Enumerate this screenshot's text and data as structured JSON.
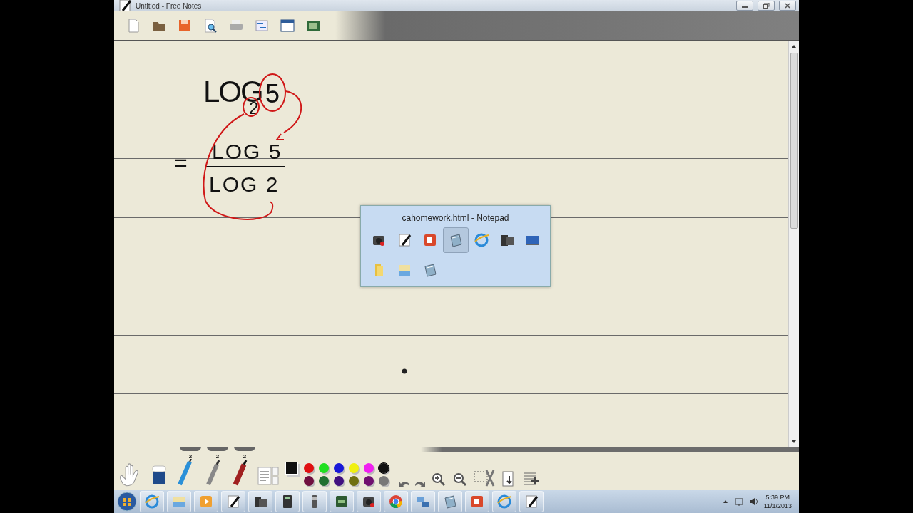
{
  "window": {
    "title": "Untitled - Free Notes"
  },
  "ink": {
    "base": "LOG",
    "subscript": "2",
    "argument": "5",
    "equals": "=",
    "numerator": "LOG 5",
    "denominator": "LOG 2"
  },
  "task_switcher": {
    "title": "cahomework.html - Notepad",
    "items": [
      {
        "selected": false
      },
      {
        "selected": false
      },
      {
        "selected": false
      },
      {
        "selected": true
      },
      {
        "selected": false
      },
      {
        "selected": false
      },
      {
        "selected": false
      },
      {
        "selected": false
      },
      {
        "selected": false
      },
      {
        "selected": false
      }
    ]
  },
  "pen_sizes": [
    "2",
    "2",
    "2"
  ],
  "palette": {
    "colors": [
      {
        "color": "#e01010",
        "selected": false
      },
      {
        "color": "#20e020",
        "selected": false
      },
      {
        "color": "#1818d8",
        "selected": false
      },
      {
        "color": "#f0f010",
        "selected": false
      },
      {
        "color": "#f020f0",
        "selected": false
      },
      {
        "color": "#101010",
        "selected": true
      },
      {
        "color": "#701040",
        "selected": false
      },
      {
        "color": "#207030",
        "selected": false
      },
      {
        "color": "#401080",
        "selected": false
      },
      {
        "color": "#707010",
        "selected": false
      },
      {
        "color": "#701070",
        "selected": false
      },
      {
        "color": "#787878",
        "selected": false
      }
    ]
  },
  "taskbar": {
    "time": "5:39 PM",
    "date": "11/1/2013"
  }
}
